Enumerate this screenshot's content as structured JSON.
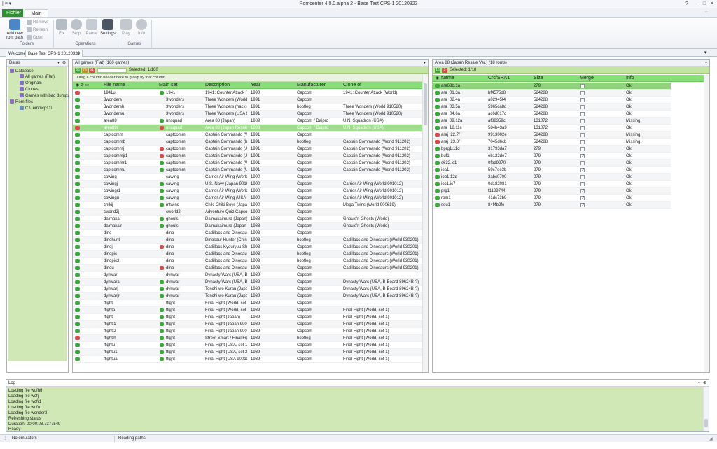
{
  "app": {
    "title": "Romcenter 4.0.0.alpha 2 - Base Test CPS-1 20120323",
    "qat_label": "|  ≡ ▾"
  },
  "ribbon": {
    "tabs": [
      "Fichier",
      "Main"
    ],
    "groups": {
      "folders": {
        "label": "Folders",
        "add_label": "Add new rom path",
        "remove": "Remove",
        "refresh": "Refresh",
        "open": "Open"
      },
      "operations": {
        "label": "Operations",
        "fix": "Fix",
        "stop": "Stop",
        "pause": "Pause",
        "settings": "Settings"
      },
      "games": {
        "label": "Games",
        "play": "Play",
        "info": "Info"
      }
    }
  },
  "doc_tabs": [
    "Welcome",
    "Base Test CPS-1 20120323"
  ],
  "datas": {
    "title": "Datas",
    "tree": [
      "Database",
      "All games (Flat)",
      "Originals",
      "Clones",
      "Games with bad dumps",
      "Rom files",
      "C:\\Temp\\cps1\\"
    ]
  },
  "games": {
    "title": "All games (Flat) (160 games)",
    "badges": [
      "63",
      "76",
      "51"
    ],
    "selected": "Selected: 1/160",
    "group_hint": "Drag a column header here to group by that column.",
    "columns": [
      "File name",
      "Main set",
      "Description",
      "Year",
      "Manufacturer",
      "Clone of"
    ],
    "rows": [
      {
        "s": "bad",
        "f": "1941u",
        "m": "1941",
        "mi": "ok",
        "d": "1941: Counter Attack (...",
        "y": "1990",
        "mf": "Capcom",
        "c": "1941: Counter Attack (World)"
      },
      {
        "s": "ok",
        "f": "3wonders",
        "m": "3wonders",
        "mi": "",
        "d": "Three Wonders (World ...",
        "y": "1991",
        "mf": "Capcom",
        "c": ""
      },
      {
        "s": "ok",
        "f": "3wondersh",
        "m": "3wonders",
        "mi": "",
        "d": "Three Wonders (hack)",
        "y": "1991",
        "mf": "bootleg",
        "c": "Three Wonders (World 910520)"
      },
      {
        "s": "ok",
        "f": "3wondersu",
        "m": "3wonders",
        "mi": "",
        "d": "Three Wonders (USA 9...",
        "y": "1991",
        "mf": "Capcom",
        "c": "Three Wonders (World 910520)"
      },
      {
        "s": "ok",
        "f": "area88",
        "m": "unsquad",
        "mi": "ok",
        "d": "Area 88 (Japan)",
        "y": "1989",
        "mf": "Capcom / Daipro",
        "c": "U.N. Squadron (USA)"
      },
      {
        "s": "bad",
        "f": "area88r",
        "m": "unsquad",
        "mi": "bad",
        "d": "Area 88 (Japan Resale ...",
        "y": "1989",
        "mf": "Capcom / Daipro",
        "c": "U.N. Squadron (USA)",
        "sel": true
      },
      {
        "s": "ok",
        "f": "captcomm",
        "m": "captcomm",
        "mi": "",
        "d": "Captain Commando (W...",
        "y": "1991",
        "mf": "Capcom",
        "c": ""
      },
      {
        "s": "ok",
        "f": "captcommb",
        "m": "captcomm",
        "mi": "",
        "d": "Captain Commando (b...",
        "y": "1991",
        "mf": "bootleg",
        "c": "Captain Commando (World 911202)"
      },
      {
        "s": "ok",
        "f": "captcommj",
        "m": "captcomm",
        "mi": "bad",
        "d": "Captain Commando (Ja...",
        "y": "1991",
        "mf": "Capcom",
        "c": "Captain Commando (World 911202)"
      },
      {
        "s": "ok",
        "f": "captcommjr1",
        "m": "captcomm",
        "mi": "bad",
        "d": "Captain Commando (Ja...",
        "y": "1991",
        "mf": "Capcom",
        "c": "Captain Commando (World 911202)"
      },
      {
        "s": "ok",
        "f": "captcommr1",
        "m": "captcomm",
        "mi": "ok",
        "d": "Captain Commando (W...",
        "y": "1991",
        "mf": "Capcom",
        "c": "Captain Commando (World 911202)"
      },
      {
        "s": "ok",
        "f": "captcommu",
        "m": "captcomm",
        "mi": "ok",
        "d": "Captain Commando (U...",
        "y": "1991",
        "mf": "Capcom",
        "c": "Captain Commando (World 911202)"
      },
      {
        "s": "ok",
        "f": "cawing",
        "m": "cawing",
        "mi": "",
        "d": "Carrier Air Wing (World...",
        "y": "1990",
        "mf": "Capcom",
        "c": ""
      },
      {
        "s": "ok",
        "f": "cawingj",
        "m": "cawing",
        "mi": "ok",
        "d": "U.S. Navy (Japan 90101...",
        "y": "1990",
        "mf": "Capcom",
        "c": "Carrier Air Wing (World 901012)"
      },
      {
        "s": "ok",
        "f": "cawingr1",
        "m": "cawing",
        "mi": "ok",
        "d": "Carrier Air Wing (World...",
        "y": "1990",
        "mf": "Capcom",
        "c": "Carrier Air Wing (World 901012)"
      },
      {
        "s": "ok",
        "f": "cawingu",
        "m": "cawing",
        "mi": "ok",
        "d": "Carrier Air Wing (USA 9...",
        "y": "1990",
        "mf": "Capcom",
        "c": "Carrier Air Wing (World 901012)"
      },
      {
        "s": "ok",
        "f": "chikij",
        "m": "mtwins",
        "mi": "ok",
        "d": "Chiki Chiki Boys (Japan...",
        "y": "1990",
        "mf": "Capcom",
        "c": "Mega Twins (World 900619)"
      },
      {
        "s": "ok",
        "f": "cworld2j",
        "m": "cworld2j",
        "mi": "",
        "d": "Adventure Quiz Capco...",
        "y": "1992",
        "mf": "Capcom",
        "c": ""
      },
      {
        "s": "ok",
        "f": "daimakai",
        "m": "ghouls",
        "mi": "ok",
        "d": "Daimakaimura (Japan)",
        "y": "1988",
        "mf": "Capcom",
        "c": "Ghouls'n Ghosts (World)"
      },
      {
        "s": "ok",
        "f": "daimakair",
        "m": "ghouls",
        "mi": "ok",
        "d": "Daimakaimura (Japan ...",
        "y": "1988",
        "mf": "Capcom",
        "c": "Ghouls'n Ghosts (World)"
      },
      {
        "s": "ok",
        "f": "dino",
        "m": "dino",
        "mi": "",
        "d": "Cadillacs and Dinosaur...",
        "y": "1993",
        "mf": "Capcom",
        "c": ""
      },
      {
        "s": "ok",
        "f": "dinohunt",
        "m": "dino",
        "mi": "",
        "d": "Dinosaur Hunter (Chin...",
        "y": "1993",
        "mf": "bootleg",
        "c": "Cadillacs and Dinosaurs (World 930201)"
      },
      {
        "s": "ok",
        "f": "dinoj",
        "m": "dino",
        "mi": "bad",
        "d": "Cadillacs Kyouryuu Shi...",
        "y": "1993",
        "mf": "Capcom",
        "c": "Cadillacs and Dinosaurs (World 930201)"
      },
      {
        "s": "ok",
        "f": "dinopic",
        "m": "dino",
        "mi": "",
        "d": "Cadillacs and Dinosaur...",
        "y": "1993",
        "mf": "bootleg",
        "c": "Cadillacs and Dinosaurs (World 930201)"
      },
      {
        "s": "ok",
        "f": "dinopic2",
        "m": "dino",
        "mi": "",
        "d": "Cadillacs and Dinosaur...",
        "y": "1993",
        "mf": "bootleg",
        "c": "Cadillacs and Dinosaurs (World 930201)"
      },
      {
        "s": "ok",
        "f": "dinou",
        "m": "dino",
        "mi": "bad",
        "d": "Cadillacs and Dinosaur...",
        "y": "1993",
        "mf": "Capcom",
        "c": "Cadillacs and Dinosaurs (World 930201)"
      },
      {
        "s": "ok",
        "f": "dynwar",
        "m": "dynwar",
        "mi": "",
        "d": "Dynasty Wars (USA, B-...",
        "y": "1989",
        "mf": "Capcom",
        "c": ""
      },
      {
        "s": "ok",
        "f": "dynwara",
        "m": "dynwar",
        "mi": "ok",
        "d": "Dynasty Wars (USA, B...",
        "y": "1989",
        "mf": "Capcom",
        "c": "Dynasty Wars (USA, B-Board 89624B-?)"
      },
      {
        "s": "ok",
        "f": "dynwarj",
        "m": "dynwar",
        "mi": "ok",
        "d": "Tenchi wo Kurau (Japan)",
        "y": "1989",
        "mf": "Capcom",
        "c": "Dynasty Wars (USA, B-Board 89624B-?)"
      },
      {
        "s": "ok",
        "f": "dynwarjr",
        "m": "dynwar",
        "mi": "ok",
        "d": "Tenchi wo Kurau (Japa...",
        "y": "1989",
        "mf": "Capcom",
        "c": "Dynasty Wars (USA, B-Board 89624B-?)"
      },
      {
        "s": "ok",
        "f": "ffight",
        "m": "ffight",
        "mi": "",
        "d": "Final Fight (World, set 1)",
        "y": "1989",
        "mf": "Capcom",
        "c": ""
      },
      {
        "s": "ok",
        "f": "ffighta",
        "m": "ffight",
        "mi": "ok",
        "d": "Final Fight (World, set 2)",
        "y": "1989",
        "mf": "Capcom",
        "c": "Final Fight (World, set 1)"
      },
      {
        "s": "ok",
        "f": "ffightj",
        "m": "ffight",
        "mi": "ok",
        "d": "Final Fight (Japan)",
        "y": "1989",
        "mf": "Capcom",
        "c": "Final Fight (World, set 1)"
      },
      {
        "s": "ok",
        "f": "ffightj1",
        "m": "ffight",
        "mi": "ok",
        "d": "Final Fight (Japan 9003...",
        "y": "1989",
        "mf": "Capcom",
        "c": "Final Fight (World, set 1)"
      },
      {
        "s": "ok",
        "f": "ffightj2",
        "m": "ffight",
        "mi": "ok",
        "d": "Final Fight (Japan 9003...",
        "y": "1989",
        "mf": "Capcom",
        "c": "Final Fight (World, set 1)"
      },
      {
        "s": "bad",
        "f": "ffightjh",
        "m": "ffight",
        "mi": "ok",
        "d": "Street Smart / Final Fig...",
        "y": "1989",
        "mf": "bootleg",
        "c": "Final Fight (World, set 1)"
      },
      {
        "s": "ok",
        "f": "ffightu",
        "m": "ffight",
        "mi": "ok",
        "d": "Final Fight (USA, set 1)",
        "y": "1989",
        "mf": "Capcom",
        "c": "Final Fight (World, set 1)"
      },
      {
        "s": "ok",
        "f": "ffightu1",
        "m": "ffight",
        "mi": "ok",
        "d": "Final Fight (USA, set 2)",
        "y": "1989",
        "mf": "Capcom",
        "c": "Final Fight (World, set 1)"
      },
      {
        "s": "ok",
        "f": "ffightua",
        "m": "ffight",
        "mi": "ok",
        "d": "Final Fight (USA 900112)",
        "y": "1989",
        "mf": "Capcom",
        "c": "Final Fight (World, set 1)"
      }
    ]
  },
  "roms": {
    "title": "Area 88 (Japan Resale Ver.) (18 roms)",
    "badges": [
      "15",
      "3"
    ],
    "selected": "Selected: 1/18",
    "columns": [
      "Name",
      "Crc/SHA1",
      "Size",
      "Merge",
      "Info"
    ],
    "rows": [
      {
        "s": "ok",
        "n": "ara63b.1a",
        "c": "",
        "z": "279",
        "m": false,
        "i": "Ok",
        "sel": true
      },
      {
        "s": "ok",
        "n": "ara_01.3a",
        "c": "bf4575d8",
        "z": "524288",
        "m": false,
        "i": "Ok"
      },
      {
        "s": "ok",
        "n": "ara_02.4a",
        "c": "a02945f4",
        "z": "524288",
        "m": false,
        "i": "Ok"
      },
      {
        "s": "ok",
        "n": "ara_03.5a",
        "c": "5965ca8d",
        "z": "524288",
        "m": false,
        "i": "Ok"
      },
      {
        "s": "ok",
        "n": "ara_04.6a",
        "c": "ac6d017d",
        "z": "524288",
        "m": false,
        "i": "Ok"
      },
      {
        "s": "ok",
        "n": "ara_09.12a",
        "c": "af88359c",
        "z": "131072",
        "m": false,
        "i": "Missing."
      },
      {
        "s": "ok",
        "n": "ara_18.11c",
        "c": "584b43a9",
        "z": "131072",
        "m": false,
        "i": "Ok"
      },
      {
        "s": "bad",
        "n": "araj_22.7f",
        "c": "9913002e",
        "z": "524288",
        "m": false,
        "i": "Missing."
      },
      {
        "s": "bad",
        "n": "araj_23.8f",
        "c": "7045d6cb",
        "z": "524288",
        "m": false,
        "i": "Missing."
      },
      {
        "s": "ok",
        "n": "bprg1.11d",
        "c": "31793da7",
        "z": "279",
        "m": false,
        "i": "Ok"
      },
      {
        "s": "ok",
        "n": "buf1",
        "c": "eb122de7",
        "z": "279",
        "m": true,
        "i": "Ok"
      },
      {
        "s": "ok",
        "n": "c632.ic1",
        "c": "0fbd9270",
        "z": "279",
        "m": false,
        "i": "Ok"
      },
      {
        "s": "ok",
        "n": "ioa1",
        "c": "59c7ee3b",
        "z": "279",
        "m": true,
        "i": "Ok"
      },
      {
        "s": "ok",
        "n": "iob1.12d",
        "c": "3abc0700",
        "z": "279",
        "m": false,
        "i": "Ok"
      },
      {
        "s": "ok",
        "n": "ioc1.ic7",
        "c": "0d182081",
        "z": "279",
        "m": false,
        "i": "Ok"
      },
      {
        "s": "ok",
        "n": "prg1",
        "c": "f1129744",
        "z": "279",
        "m": true,
        "i": "Ok"
      },
      {
        "s": "ok",
        "n": "rom1",
        "c": "41dc73b9",
        "z": "279",
        "m": true,
        "i": "Ok"
      },
      {
        "s": "ok",
        "n": "sou1",
        "c": "84f4b2fe",
        "z": "279",
        "m": true,
        "i": "Ok"
      }
    ]
  },
  "log": {
    "title": "Log",
    "lines": [
      "Loading file wofhfh",
      "Loading file wofj",
      "Loading file wofr1",
      "Loading file wofu",
      "Loading file wonder3",
      "Refreshing status",
      "Duration: 00:00:08.7377549",
      "Ready"
    ]
  },
  "status": {
    "emulators": "No emulators",
    "activity": "Reading paths"
  },
  "colors": {
    "accent_green": "#88df7a",
    "panel_green": "#cfe8b5",
    "ok_icon": "#3aa93a",
    "bad_icon": "#d94a4a",
    "file_tab": "#2f8f2f"
  }
}
